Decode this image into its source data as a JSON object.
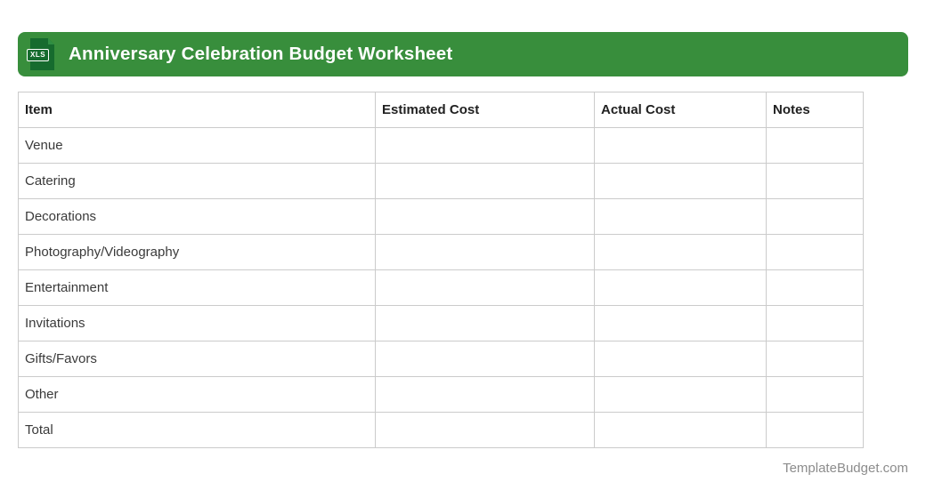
{
  "header": {
    "title": "Anniversary Celebration Budget Worksheet",
    "file_badge": "XLS"
  },
  "colors": {
    "header_bar": "#388E3C",
    "icon_dark_green": "#166B2E",
    "table_border": "#CBCBCB",
    "header_text": "#FFFFFF",
    "cell_text": "#3A3A3A",
    "footer_text": "#8C8C8C"
  },
  "table": {
    "columns": [
      {
        "label": "Item"
      },
      {
        "label": "Estimated Cost"
      },
      {
        "label": "Actual Cost"
      },
      {
        "label": "Notes"
      }
    ],
    "rows": [
      {
        "item": "Venue",
        "estimated_cost": "",
        "actual_cost": "",
        "notes": ""
      },
      {
        "item": "Catering",
        "estimated_cost": "",
        "actual_cost": "",
        "notes": ""
      },
      {
        "item": "Decorations",
        "estimated_cost": "",
        "actual_cost": "",
        "notes": ""
      },
      {
        "item": "Photography/Videography",
        "estimated_cost": "",
        "actual_cost": "",
        "notes": ""
      },
      {
        "item": "Entertainment",
        "estimated_cost": "",
        "actual_cost": "",
        "notes": ""
      },
      {
        "item": "Invitations",
        "estimated_cost": "",
        "actual_cost": "",
        "notes": ""
      },
      {
        "item": "Gifts/Favors",
        "estimated_cost": "",
        "actual_cost": "",
        "notes": ""
      },
      {
        "item": "Other",
        "estimated_cost": "",
        "actual_cost": "",
        "notes": ""
      },
      {
        "item": "Total",
        "estimated_cost": "",
        "actual_cost": "",
        "notes": ""
      }
    ]
  },
  "footer": {
    "site_name": "TemplateBudget.com"
  }
}
